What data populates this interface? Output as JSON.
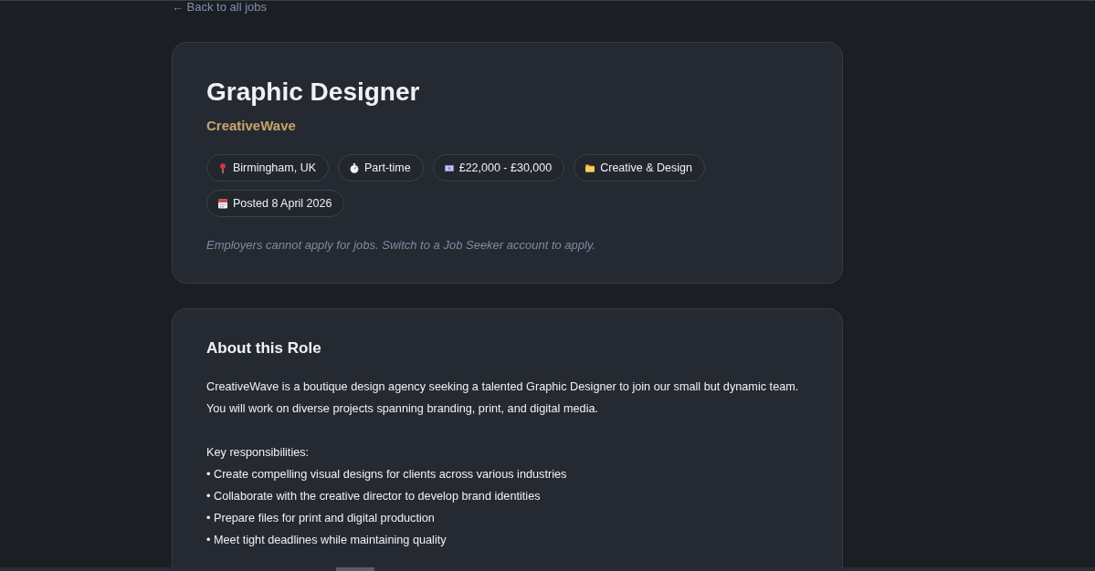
{
  "back_link": {
    "label": "← Back to all jobs"
  },
  "job": {
    "title": "Graphic Designer",
    "company": "CreativeWave",
    "meta": [
      {
        "kind": "location",
        "label": "Birmingham, UK"
      },
      {
        "kind": "job_type",
        "label": "Part-time"
      },
      {
        "kind": "salary",
        "label": "£22,000 - £30,000"
      },
      {
        "kind": "category",
        "label": "Creative & Design"
      },
      {
        "kind": "posted",
        "label": "Posted 8 April 2026"
      }
    ],
    "notice": "Employers cannot apply for jobs. Switch to a Job Seeker account to apply."
  },
  "about": {
    "heading": "About this Role",
    "description": "CreativeWave is a boutique design agency seeking a talented Graphic Designer to join our small but dynamic team.\nYou will work on diverse projects spanning branding, print, and digital media.\n\nKey responsibilities:\n• Create compelling visual designs for clients across various industries\n• Collaborate with the creative director to develop brand identities\n• Prepare files for print and digital production\n• Meet tight deadlines while maintaining quality"
  }
}
